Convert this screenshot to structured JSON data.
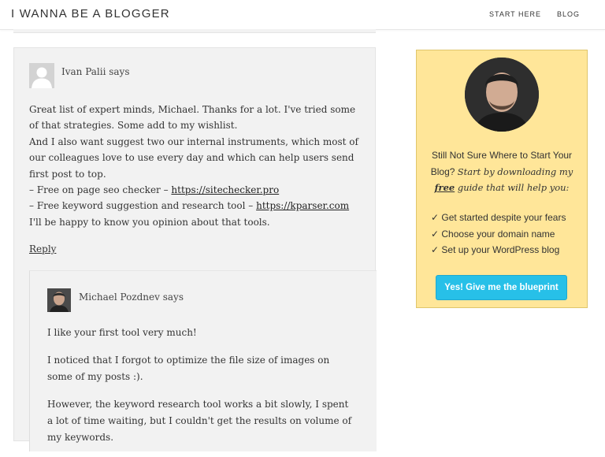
{
  "header": {
    "site_title": "I WANNA BE A BLOGGER",
    "nav": [
      "START HERE",
      "BLOG"
    ]
  },
  "comment": {
    "author": "Ivan Palii says",
    "line1": "Great list of expert minds, Michael. Thanks for a lot. I've tried some of that strategies. Some add to my wishlist.",
    "line2": "And I also want suggest two our internal instruments, which most of our colleagues love to use every day and which can help users send first post to top.",
    "item1_prefix": "– Free on page seo checker – ",
    "item1_link": "https://sitechecker.pro",
    "item2_prefix": "– Free keyword suggestion and research tool – ",
    "item2_link": "https://kparser.com",
    "line3": "I'll be happy to know you opinion about that tools.",
    "reply": "Reply"
  },
  "reply_comment": {
    "author": "Michael Pozdnev says",
    "paragraphs": [
      "I like your first tool very much!",
      "I noticed that I forgot to optimize the file size of images on some of my posts :).",
      "However, the keyword research tool works a bit slowly, I spent a lot of time waiting, but I couldn't get the results on volume of my keywords."
    ]
  },
  "sidebar": {
    "heading": "Still Not Sure Where to Start Your Blog?",
    "italic_pre": "Start by downloading my ",
    "italic_free": "free",
    "italic_post": " guide that will help you:",
    "checklist": [
      "✓ Get started despite your fears",
      "✓ Choose your domain name",
      "✓ Set up your WordPress blog"
    ],
    "cta": "Yes! Give me the blueprint",
    "colors": {
      "panel": "#ffe699",
      "cta": "#27c0e8"
    }
  }
}
